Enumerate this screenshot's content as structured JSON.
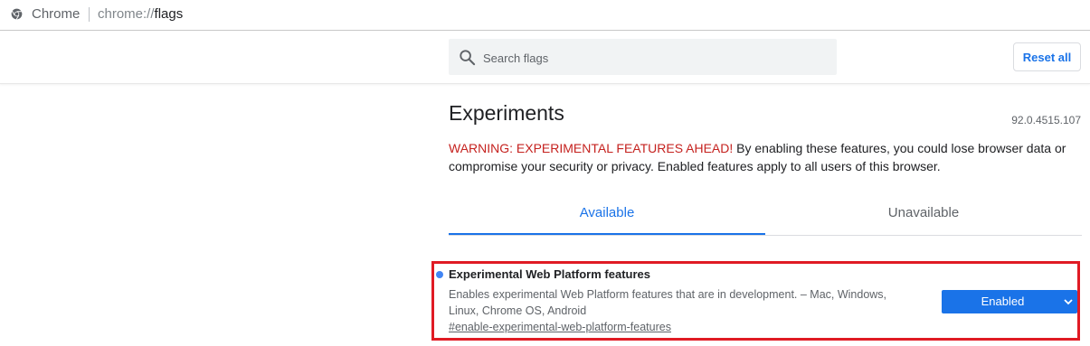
{
  "browser": {
    "app_name": "Chrome",
    "url_scheme": "chrome://",
    "url_host": "flags"
  },
  "header": {
    "search_placeholder": "Search flags",
    "reset_label": "Reset all"
  },
  "page": {
    "title": "Experiments",
    "version": "92.0.4515.107",
    "warning_strong": "WARNING: EXPERIMENTAL FEATURES AHEAD!",
    "warning_text": " By enabling these features, you could lose browser data or compromise your security or privacy. Enabled features apply to all users of this browser."
  },
  "tabs": [
    {
      "label": "Available",
      "selected": true
    },
    {
      "label": "Unavailable",
      "selected": false
    }
  ],
  "experiment": {
    "name": "Experimental Web Platform features",
    "description": "Enables experimental Web Platform features that are in development. – Mac, Windows, Linux, Chrome OS, Android",
    "link": "#enable-experimental-web-platform-features",
    "state": "Enabled"
  },
  "colors": {
    "accent": "#1a73e8",
    "warning": "#c5221f",
    "highlight_box": "#e01b24"
  },
  "icons": [
    "chrome-icon",
    "search-icon",
    "chevron-down-icon"
  ]
}
